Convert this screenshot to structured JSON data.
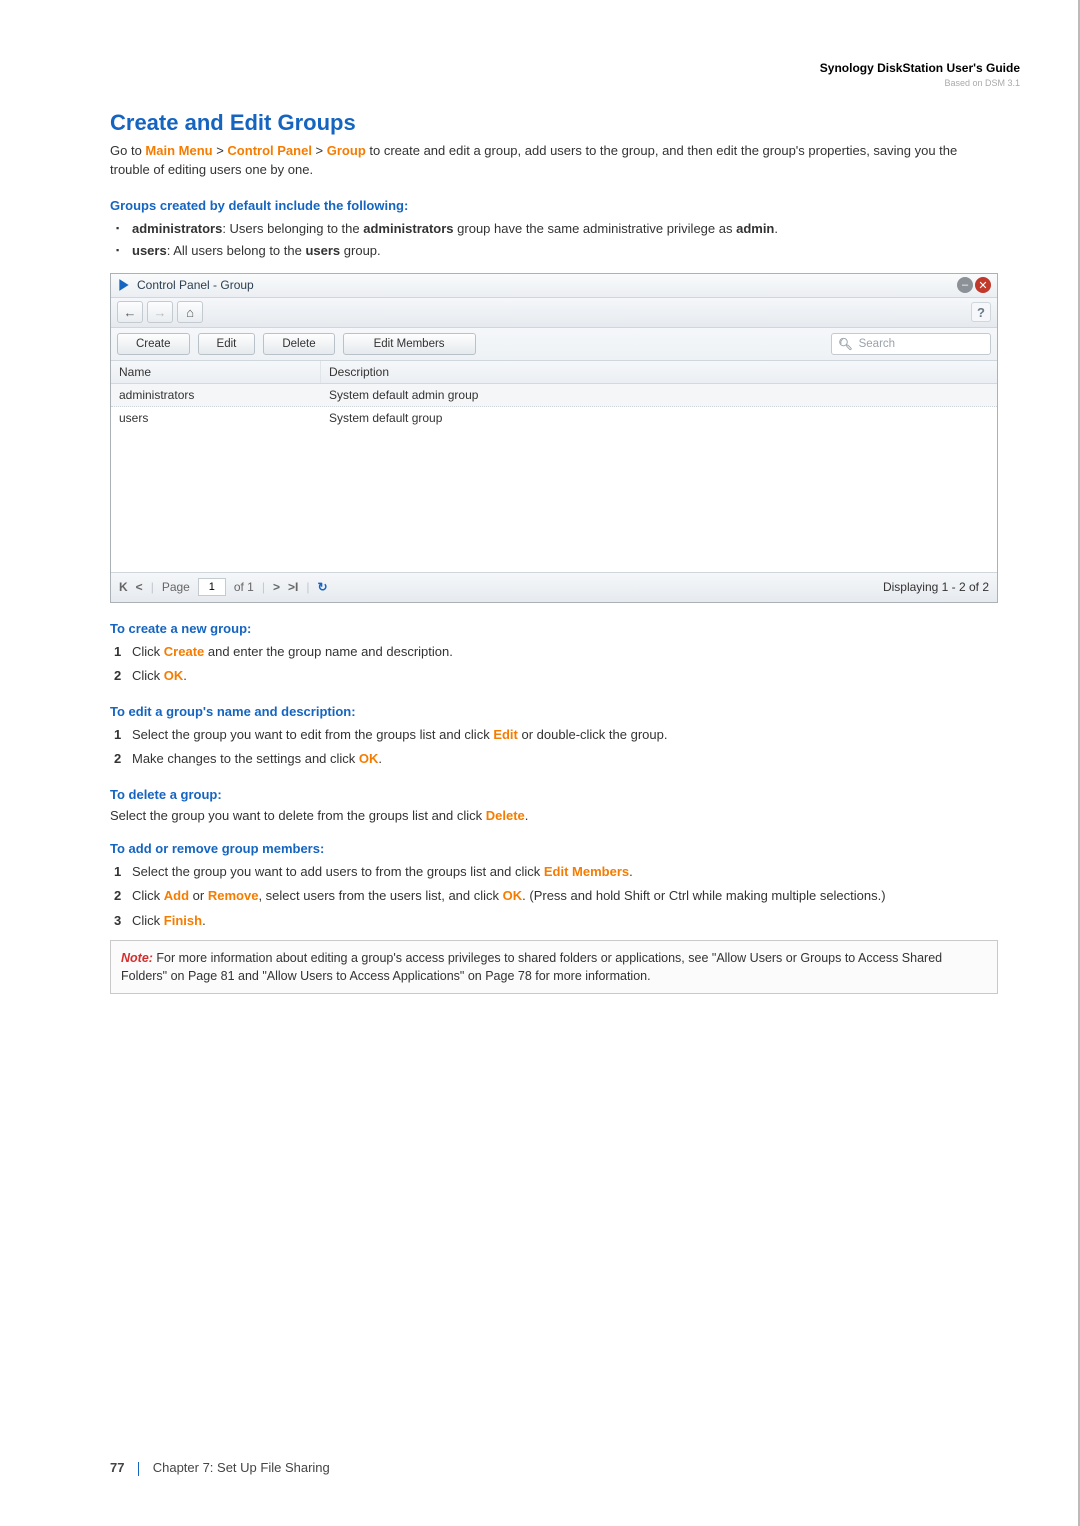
{
  "doc_header": {
    "title": "Synology DiskStation User's Guide",
    "subtitle": "Based on DSM 3.1"
  },
  "page_title": "Create and Edit Groups",
  "intro": {
    "prefix": "Go to ",
    "link1": "Main Menu",
    "gt1": " > ",
    "link2": "Control Panel",
    "gt2": " > ",
    "link3": "Group",
    "suffix": " to create and edit a group, add users to the group, and then edit the group's properties, saving you the trouble of editing users one by one."
  },
  "defaults_heading": "Groups created by default include the following:",
  "defaults_items": [
    {
      "b1": "administrators",
      "mid": ": Users belonging to the ",
      "b2": "administrators",
      "suffix": " group have the same administrative privilege as ",
      "b3": "admin",
      "end": "."
    },
    {
      "b1": "users",
      "mid": ": All users belong to the ",
      "b2": "users",
      "suffix": " group.",
      "b3": "",
      "end": ""
    }
  ],
  "window": {
    "title": "Control Panel - Group",
    "help": "?",
    "toolbar": {
      "create": "Create",
      "edit": "Edit",
      "delete": "Delete",
      "edit_members": "Edit Members",
      "search_placeholder": "Search"
    },
    "columns": {
      "name": "Name",
      "description": "Description"
    },
    "rows": [
      {
        "name": "administrators",
        "description": "System default admin group"
      },
      {
        "name": "users",
        "description": "System default group"
      }
    ],
    "pager": {
      "page_label": "Page",
      "page_value": "1",
      "of_label": "of 1",
      "display": "Displaying 1 - 2 of 2"
    }
  },
  "sec_create": {
    "heading": "To create a new group:"
  },
  "sec_create_steps": {
    "s1_a": "Click ",
    "s1_link": "Create",
    "s1_b": " and enter the group name and description.",
    "s2_a": "Click ",
    "s2_link": "OK",
    "s2_b": "."
  },
  "sec_editname": {
    "heading": "To edit a group's name and description:"
  },
  "sec_editname_steps": {
    "s1_a": "Select the group you want to edit from the groups list and click ",
    "s1_link": "Edit",
    "s1_b": " or double-click the group.",
    "s2_a": "Make changes to the settings and click ",
    "s2_link": "OK",
    "s2_b": "."
  },
  "sec_delete": {
    "heading": "To delete a group:",
    "text_a": "Select the group you want to delete from the groups list and click ",
    "link": "Delete",
    "text_b": "."
  },
  "sec_members": {
    "heading": "To add or remove group members:"
  },
  "sec_members_steps": {
    "s1_a": "Select the group you want to add users to from the groups list and click ",
    "s1_link": "Edit Members",
    "s1_b": ".",
    "s2_a": "Click ",
    "s2_link1": "Add",
    "s2_mid": " or ",
    "s2_link2": "Remove",
    "s2_b": ", select users from the users list, and click ",
    "s2_link3": "OK",
    "s2_c": ". (Press and hold Shift or Ctrl while making multiple selections.)",
    "s3_a": "Click ",
    "s3_link": "Finish",
    "s3_b": "."
  },
  "note": {
    "label": "Note:",
    "body": " For more information about editing a group's access privileges to shared folders or applications, see \"Allow Users or Groups to Access Shared Folders\" on Page 81 and \"Allow Users to Access Applications\" on Page 78 for more information."
  },
  "footer": {
    "page_num": "77",
    "chapter": "Chapter 7: Set Up File Sharing"
  }
}
